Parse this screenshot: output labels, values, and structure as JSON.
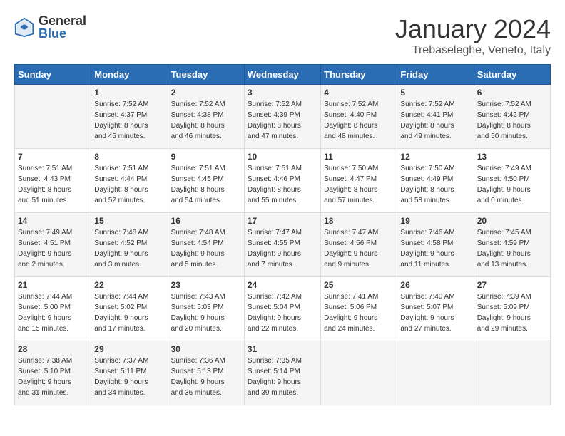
{
  "header": {
    "logo_general": "General",
    "logo_blue": "Blue",
    "month_title": "January 2024",
    "location": "Trebaseleghe, Veneto, Italy"
  },
  "days_of_week": [
    "Sunday",
    "Monday",
    "Tuesday",
    "Wednesday",
    "Thursday",
    "Friday",
    "Saturday"
  ],
  "weeks": [
    [
      {
        "day": "",
        "info": ""
      },
      {
        "day": "1",
        "info": "Sunrise: 7:52 AM\nSunset: 4:37 PM\nDaylight: 8 hours\nand 45 minutes."
      },
      {
        "day": "2",
        "info": "Sunrise: 7:52 AM\nSunset: 4:38 PM\nDaylight: 8 hours\nand 46 minutes."
      },
      {
        "day": "3",
        "info": "Sunrise: 7:52 AM\nSunset: 4:39 PM\nDaylight: 8 hours\nand 47 minutes."
      },
      {
        "day": "4",
        "info": "Sunrise: 7:52 AM\nSunset: 4:40 PM\nDaylight: 8 hours\nand 48 minutes."
      },
      {
        "day": "5",
        "info": "Sunrise: 7:52 AM\nSunset: 4:41 PM\nDaylight: 8 hours\nand 49 minutes."
      },
      {
        "day": "6",
        "info": "Sunrise: 7:52 AM\nSunset: 4:42 PM\nDaylight: 8 hours\nand 50 minutes."
      }
    ],
    [
      {
        "day": "7",
        "info": "Sunrise: 7:51 AM\nSunset: 4:43 PM\nDaylight: 8 hours\nand 51 minutes."
      },
      {
        "day": "8",
        "info": "Sunrise: 7:51 AM\nSunset: 4:44 PM\nDaylight: 8 hours\nand 52 minutes."
      },
      {
        "day": "9",
        "info": "Sunrise: 7:51 AM\nSunset: 4:45 PM\nDaylight: 8 hours\nand 54 minutes."
      },
      {
        "day": "10",
        "info": "Sunrise: 7:51 AM\nSunset: 4:46 PM\nDaylight: 8 hours\nand 55 minutes."
      },
      {
        "day": "11",
        "info": "Sunrise: 7:50 AM\nSunset: 4:47 PM\nDaylight: 8 hours\nand 57 minutes."
      },
      {
        "day": "12",
        "info": "Sunrise: 7:50 AM\nSunset: 4:49 PM\nDaylight: 8 hours\nand 58 minutes."
      },
      {
        "day": "13",
        "info": "Sunrise: 7:49 AM\nSunset: 4:50 PM\nDaylight: 9 hours\nand 0 minutes."
      }
    ],
    [
      {
        "day": "14",
        "info": "Sunrise: 7:49 AM\nSunset: 4:51 PM\nDaylight: 9 hours\nand 2 minutes."
      },
      {
        "day": "15",
        "info": "Sunrise: 7:48 AM\nSunset: 4:52 PM\nDaylight: 9 hours\nand 3 minutes."
      },
      {
        "day": "16",
        "info": "Sunrise: 7:48 AM\nSunset: 4:54 PM\nDaylight: 9 hours\nand 5 minutes."
      },
      {
        "day": "17",
        "info": "Sunrise: 7:47 AM\nSunset: 4:55 PM\nDaylight: 9 hours\nand 7 minutes."
      },
      {
        "day": "18",
        "info": "Sunrise: 7:47 AM\nSunset: 4:56 PM\nDaylight: 9 hours\nand 9 minutes."
      },
      {
        "day": "19",
        "info": "Sunrise: 7:46 AM\nSunset: 4:58 PM\nDaylight: 9 hours\nand 11 minutes."
      },
      {
        "day": "20",
        "info": "Sunrise: 7:45 AM\nSunset: 4:59 PM\nDaylight: 9 hours\nand 13 minutes."
      }
    ],
    [
      {
        "day": "21",
        "info": "Sunrise: 7:44 AM\nSunset: 5:00 PM\nDaylight: 9 hours\nand 15 minutes."
      },
      {
        "day": "22",
        "info": "Sunrise: 7:44 AM\nSunset: 5:02 PM\nDaylight: 9 hours\nand 17 minutes."
      },
      {
        "day": "23",
        "info": "Sunrise: 7:43 AM\nSunset: 5:03 PM\nDaylight: 9 hours\nand 20 minutes."
      },
      {
        "day": "24",
        "info": "Sunrise: 7:42 AM\nSunset: 5:04 PM\nDaylight: 9 hours\nand 22 minutes."
      },
      {
        "day": "25",
        "info": "Sunrise: 7:41 AM\nSunset: 5:06 PM\nDaylight: 9 hours\nand 24 minutes."
      },
      {
        "day": "26",
        "info": "Sunrise: 7:40 AM\nSunset: 5:07 PM\nDaylight: 9 hours\nand 27 minutes."
      },
      {
        "day": "27",
        "info": "Sunrise: 7:39 AM\nSunset: 5:09 PM\nDaylight: 9 hours\nand 29 minutes."
      }
    ],
    [
      {
        "day": "28",
        "info": "Sunrise: 7:38 AM\nSunset: 5:10 PM\nDaylight: 9 hours\nand 31 minutes."
      },
      {
        "day": "29",
        "info": "Sunrise: 7:37 AM\nSunset: 5:11 PM\nDaylight: 9 hours\nand 34 minutes."
      },
      {
        "day": "30",
        "info": "Sunrise: 7:36 AM\nSunset: 5:13 PM\nDaylight: 9 hours\nand 36 minutes."
      },
      {
        "day": "31",
        "info": "Sunrise: 7:35 AM\nSunset: 5:14 PM\nDaylight: 9 hours\nand 39 minutes."
      },
      {
        "day": "",
        "info": ""
      },
      {
        "day": "",
        "info": ""
      },
      {
        "day": "",
        "info": ""
      }
    ]
  ]
}
